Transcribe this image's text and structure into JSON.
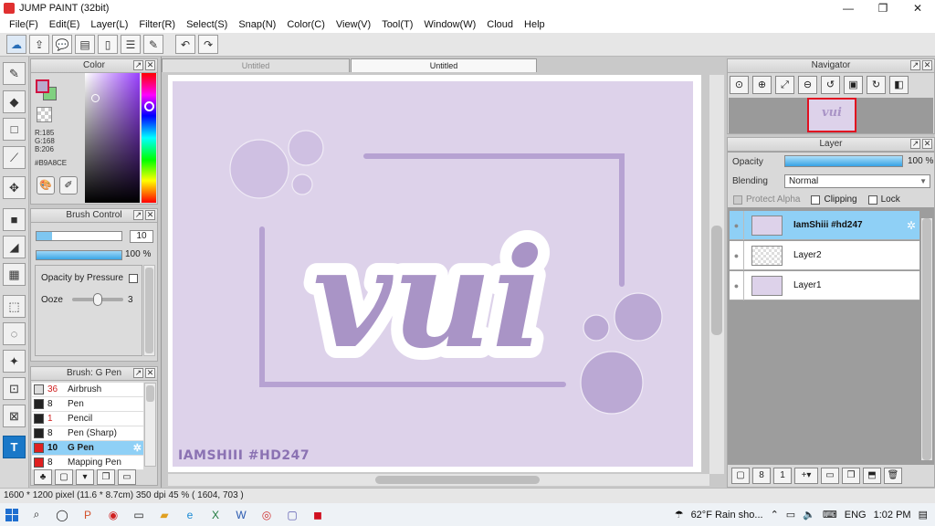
{
  "window": {
    "title": "JUMP PAINT (32bit)",
    "min": "—",
    "max": "❐",
    "close": "✕"
  },
  "menu": [
    "File(F)",
    "Edit(E)",
    "Layer(L)",
    "Filter(R)",
    "Select(S)",
    "Snap(N)",
    "Color(C)",
    "View(V)",
    "Tool(T)",
    "Window(W)",
    "Cloud",
    "Help"
  ],
  "toolbar_icons": [
    "cloud-icon",
    "share-icon",
    "speech-bubble-icon",
    "comment-icon",
    "page-icon",
    "list-icon",
    "edit-icon",
    "undo-icon",
    "redo-icon"
  ],
  "tools": [
    "brush-icon",
    "eraser-icon",
    "rectangle-icon",
    "line-icon",
    "move-icon",
    "fill-rect-icon",
    "bucket-icon",
    "gradient-icon",
    "rect-select-icon",
    "lasso-icon",
    "magic-wand-icon",
    "select-pen-icon",
    "select-eraser-icon",
    "text-icon"
  ],
  "color_panel": {
    "title": "Color",
    "r": "R:185",
    "g": "G:168",
    "b": "B:206",
    "hex": "#B9A8CE",
    "fg_color": "#B9A8CE"
  },
  "brush_control": {
    "title": "Brush Control",
    "size": "10",
    "opacity": "100 %",
    "opacity_by_pressure": "Opacity by Pressure",
    "ooze_label": "Ooze",
    "ooze_value": "3"
  },
  "brush_list": {
    "title": "Brush: G Pen",
    "items": [
      {
        "size": "36",
        "name": "Airbrush",
        "color": "#dddddd",
        "size_color": "#d02020"
      },
      {
        "size": "8",
        "name": "Pen",
        "color": "#222222",
        "size_color": "#111111"
      },
      {
        "size": "1",
        "name": "Pencil",
        "color": "#222222",
        "size_color": "#d02020"
      },
      {
        "size": "8",
        "name": "Pen (Sharp)",
        "color": "#222222",
        "size_color": "#111111"
      },
      {
        "size": "10",
        "name": "G Pen",
        "color": "#e02020",
        "size_color": "#111111",
        "active": true
      },
      {
        "size": "8",
        "name": "Mapping Pen",
        "color": "#e02020",
        "size_color": "#111111"
      }
    ]
  },
  "canvas": {
    "tab_inactive": "Untitled",
    "tab_active": "Untitled",
    "art_text": "vui",
    "caption": "IAMSHIII #HD247"
  },
  "navigator": {
    "title": "Navigator",
    "thumb_text": "vui"
  },
  "layer_panel": {
    "title": "Layer",
    "opacity_label": "Opacity",
    "opacity_value": "100 %",
    "blending_label": "Blending",
    "blending_value": "Normal",
    "protect_alpha": "Protect Alpha",
    "clipping": "Clipping",
    "lock": "Lock",
    "layers": [
      {
        "name": "IamShiii #hd247",
        "active": true
      },
      {
        "name": "Layer2",
        "active": false
      },
      {
        "name": "Layer1",
        "active": false
      }
    ]
  },
  "status": {
    "text": "1600 * 1200 pixel  (11.6 * 8.7cm)  350 dpi  45 %  ( 1604, 703 )"
  },
  "taskbar": {
    "weather": "62°F  Rain sho...",
    "lang": "ENG",
    "time": "1:02 PM"
  }
}
